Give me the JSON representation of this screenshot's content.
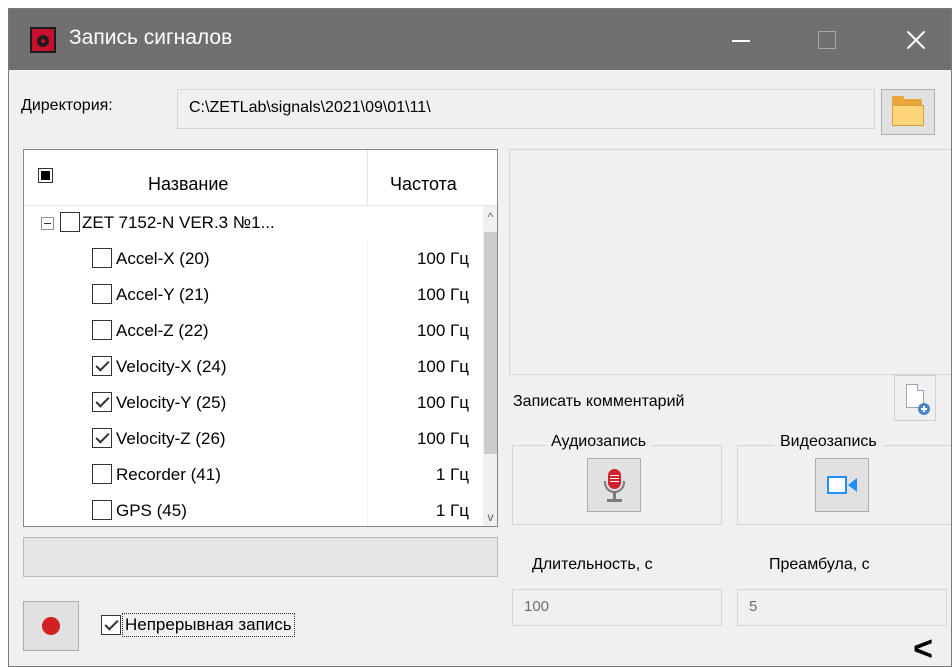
{
  "window": {
    "title": "Запись сигналов",
    "icon": "red-recorder-app-icon"
  },
  "directory": {
    "label": "Директория:",
    "path": "C:\\ZETLab\\signals\\2021\\09\\01\\11\\",
    "browse_icon": "folder-icon"
  },
  "tree": {
    "header_name": "Название",
    "header_freq": "Частота",
    "header_checkbox_state": "indeterminate",
    "device": {
      "label": "ZET 7152-N VER.3 №1...",
      "expanded": true,
      "checked": false
    },
    "channels": [
      {
        "label": "Accel-X (20)",
        "freq": "100 Гц",
        "checked": false
      },
      {
        "label": "Accel-Y (21)",
        "freq": "100 Гц",
        "checked": false
      },
      {
        "label": "Accel-Z (22)",
        "freq": "100 Гц",
        "checked": false
      },
      {
        "label": "Velocity-X (24)",
        "freq": "100 Гц",
        "checked": true
      },
      {
        "label": "Velocity-Y (25)",
        "freq": "100 Гц",
        "checked": true
      },
      {
        "label": "Velocity-Z (26)",
        "freq": "100 Гц",
        "checked": true
      },
      {
        "label": "Recorder (41)",
        "freq": "1 Гц",
        "checked": false
      },
      {
        "label": "GPS (45)",
        "freq": "1 Гц",
        "checked": false
      }
    ],
    "scroll_up_glyph": "^",
    "scroll_down_glyph": "v"
  },
  "comment": {
    "label": "Записать комментарий",
    "add_icon": "add-document-icon"
  },
  "audio": {
    "group_label": "Аудиозапись",
    "icon": "microphone-icon"
  },
  "video": {
    "group_label": "Видеозапись",
    "icon": "video-camera-icon"
  },
  "duration": {
    "label": "Длительность, с",
    "value": "100"
  },
  "preamble": {
    "label": "Преамбула, с",
    "value": "5"
  },
  "record": {
    "icon": "record-icon",
    "continuous_label": "Непрерывная запись",
    "continuous_checked": true
  },
  "collapse_glyph": "<",
  "colors": {
    "titlebar": "#707070",
    "record_red": "#d32020",
    "mic_red": "#d3202e",
    "camera_blue": "#1e90ff",
    "folder_yellow": "#fcd57a"
  }
}
